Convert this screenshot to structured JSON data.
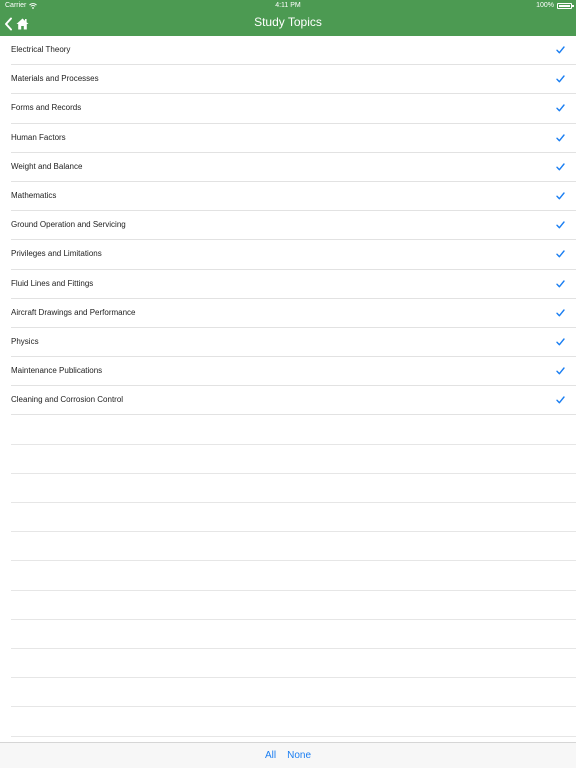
{
  "status_bar": {
    "carrier": "Carrier",
    "time": "4:11 PM",
    "battery": "100%"
  },
  "nav": {
    "title": "Study Topics",
    "back_icon": "chevron-left-icon",
    "home_icon": "home-icon"
  },
  "topics": [
    {
      "label": "Electrical Theory",
      "checked": true
    },
    {
      "label": "Materials and Processes",
      "checked": true
    },
    {
      "label": "Forms and Records",
      "checked": true
    },
    {
      "label": "Human Factors",
      "checked": true
    },
    {
      "label": "Weight and Balance",
      "checked": true
    },
    {
      "label": "Mathematics",
      "checked": true
    },
    {
      "label": "Ground Operation and Servicing",
      "checked": true
    },
    {
      "label": "Privileges and Limitations",
      "checked": true
    },
    {
      "label": "Fluid Lines and Fittings",
      "checked": true
    },
    {
      "label": "Aircraft Drawings and Performance",
      "checked": true
    },
    {
      "label": "Physics",
      "checked": true
    },
    {
      "label": "Maintenance Publications",
      "checked": true
    },
    {
      "label": "Cleaning and Corrosion Control",
      "checked": true
    }
  ],
  "toolbar": {
    "all_label": "All",
    "none_label": "None"
  },
  "colors": {
    "header": "#4c9a52",
    "accent": "#1a7ef2"
  }
}
